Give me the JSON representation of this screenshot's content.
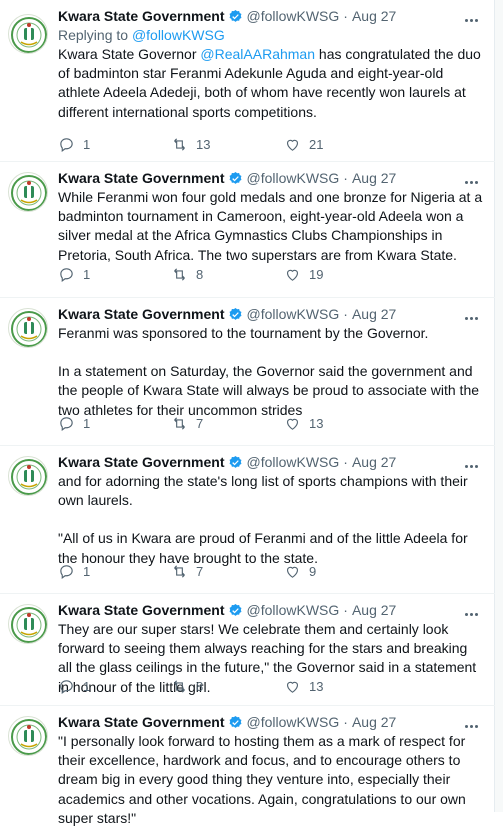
{
  "author": {
    "name": "Kwara State Government",
    "handle": "@followKWSG",
    "separator": "·"
  },
  "tweets": [
    {
      "date": "Aug 27",
      "replying_prefix": "Replying to ",
      "replying_to": "@followKWSG",
      "text_before": "Kwara State Governor ",
      "mention": "@RealAARahman",
      "text_after": " has congratulated the duo of badminton star Feranmi Adekunle Aguda and eight-year-old athlete Adeela Adedeji, both of whom have recently won laurels at different international sports competitions.",
      "replies": "1",
      "retweets": "13",
      "likes": "21"
    },
    {
      "date": "Aug 27",
      "paragraphs": [
        "While Feranmi won four gold medals and one bronze for Nigeria at a badminton tournament in Cameroon, eight-year-old Adeela won a silver medal at the Africa Gymnastics Clubs Championships in Pretoria, South Africa. The two superstars are from Kwara State."
      ],
      "replies": "1",
      "retweets": "8",
      "likes": "19"
    },
    {
      "date": "Aug 27",
      "paragraphs": [
        "Feranmi was sponsored to the tournament by the Governor.",
        "In a statement on Saturday, the Governor said the government and the people of Kwara State will always be proud to associate with the two athletes for their uncommon strides"
      ],
      "replies": "1",
      "retweets": "7",
      "likes": "13"
    },
    {
      "date": "Aug 27",
      "paragraphs": [
        "and for adorning the state's long list of sports champions with their own laurels.",
        "\"All of us in Kwara are proud of Feranmi and of the little Adeela for the honour they have brought to the state."
      ],
      "replies": "1",
      "retweets": "7",
      "likes": "9"
    },
    {
      "date": "Aug 27",
      "paragraphs": [
        "They are our super stars! We celebrate them and certainly look forward to seeing them always reaching for the stars and breaking all the glass ceilings in the future,\" the Governor said in a statement in honour of the little girl."
      ],
      "replies": "1",
      "retweets": "8",
      "likes": "13"
    },
    {
      "date": "Aug 27",
      "paragraphs": [
        "\"I personally look forward to hosting them as a mark of respect for their excellence, hardwork and focus, and to encourage others to dream big in every good thing they venture into, especially their academics and other vocations. Again, congratulations to our own super stars!\""
      ]
    }
  ],
  "icons": {
    "reply": "reply-icon",
    "retweet": "retweet-icon",
    "like": "heart-icon",
    "more": "more-options-icon",
    "verified": "verified-badge-icon",
    "avatar": "kwara-state-seal-avatar"
  },
  "colors": {
    "link": "#1d9bf0",
    "muted": "#536471",
    "text": "#0f1419",
    "verified": "#1d9bf0"
  }
}
